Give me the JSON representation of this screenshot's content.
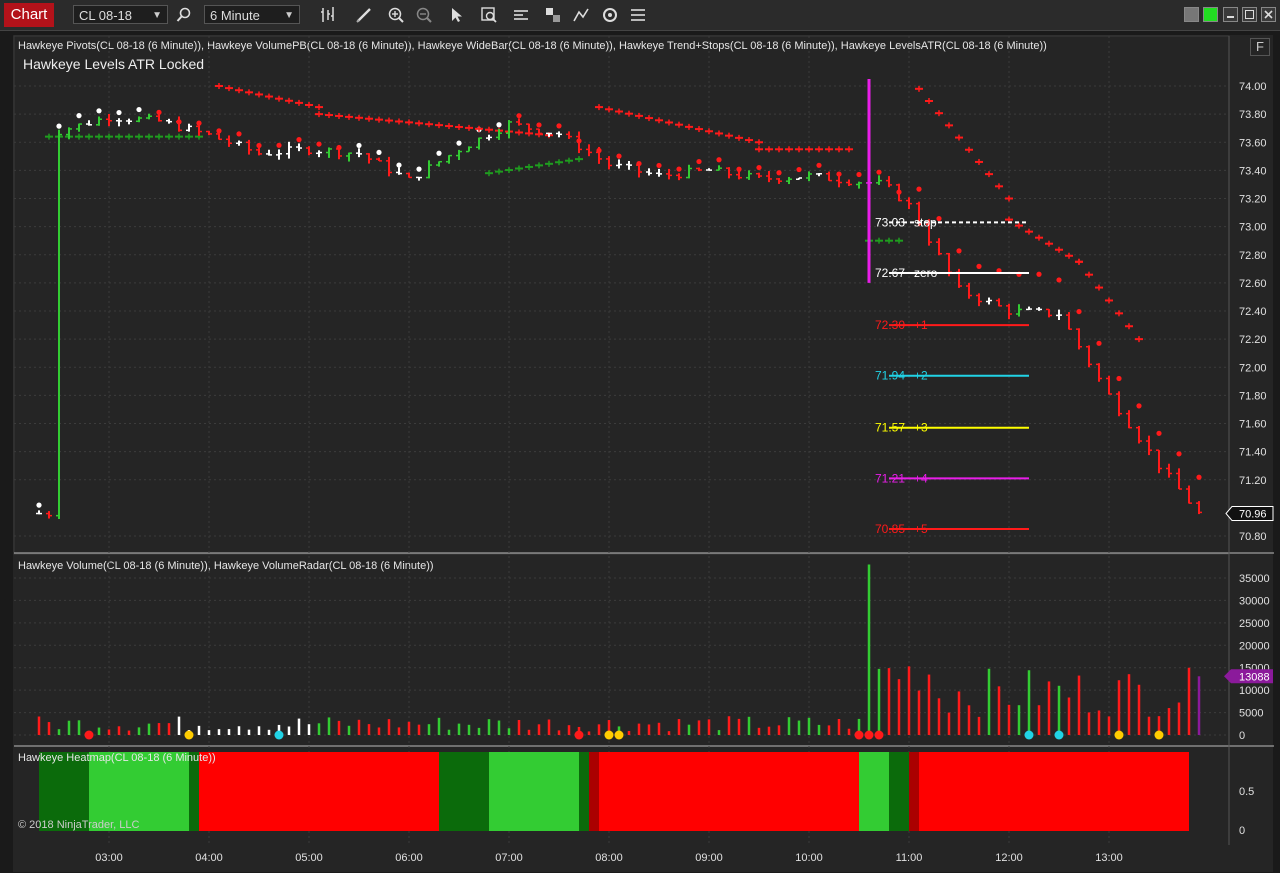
{
  "toolbar": {
    "tab_label": "Chart",
    "instrument": "CL 08-18",
    "interval": "6 Minute"
  },
  "price_panel": {
    "title": "Hawkeye Pivots(CL 08-18 (6 Minute)), Hawkeye VolumePB(CL 08-18 (6 Minute)), Hawkeye WideBar(CL 08-18 (6 Minute)), Hawkeye Trend+Stops(CL 08-18 (6 Minute)), Hawkeye LevelsATR(CL 08-18 (6 Minute))",
    "subtitle": "Hawkeye Levels ATR Locked",
    "float_button": "F",
    "y_ticks": [
      "74.00",
      "73.80",
      "73.60",
      "73.40",
      "73.20",
      "73.00",
      "72.80",
      "72.60",
      "72.40",
      "72.20",
      "72.00",
      "71.80",
      "71.60",
      "71.40",
      "71.20",
      "70.80"
    ],
    "y_tick_values": [
      74.0,
      73.8,
      73.6,
      73.4,
      73.2,
      73.0,
      72.8,
      72.6,
      72.4,
      72.2,
      72.0,
      71.8,
      71.6,
      71.4,
      71.2,
      70.8
    ],
    "last_price": "70.96",
    "last_price_value": 70.96,
    "levels": [
      {
        "price": "73.03",
        "label": "stop",
        "value": 73.03,
        "color": "#ffffff",
        "style": "dashed"
      },
      {
        "price": "72.67",
        "label": "zero",
        "value": 72.67,
        "color": "#ffffff",
        "style": "solid"
      },
      {
        "price": "72.30",
        "label": "+1",
        "value": 72.3,
        "color": "#ff1a1a",
        "style": "solid"
      },
      {
        "price": "71.94",
        "label": "+2",
        "value": 71.94,
        "color": "#21d3e6",
        "style": "solid"
      },
      {
        "price": "71.57",
        "label": "+3",
        "value": 71.57,
        "color": "#ffff00",
        "style": "solid"
      },
      {
        "price": "71.21",
        "label": "+4",
        "value": 71.21,
        "color": "#e91ee9",
        "style": "solid"
      },
      {
        "price": "70.85",
        "label": "+5",
        "value": 70.85,
        "color": "#ff1a1a",
        "style": "solid"
      }
    ]
  },
  "volume_panel": {
    "title": "Hawkeye Volume(CL 08-18 (6 Minute)), Hawkeye VolumeRadar(CL 08-18 (6 Minute))",
    "y_ticks": [
      "35000",
      "30000",
      "25000",
      "20000",
      "15000",
      "10000",
      "5000",
      "0"
    ],
    "y_tick_values": [
      35000,
      30000,
      25000,
      20000,
      15000,
      10000,
      5000,
      0
    ],
    "last_volume": "13088",
    "last_volume_value": 13088
  },
  "heatmap_panel": {
    "title": "Hawkeye Heatmap(CL 08-18 (6 Minute))",
    "y_ticks": [
      "0.5",
      "0"
    ],
    "copyright": "© 2018 NinjaTrader, LLC"
  },
  "x_axis": {
    "labels": [
      "03:00",
      "04:00",
      "05:00",
      "06:00",
      "07:00",
      "08:00",
      "09:00",
      "10:00",
      "11:00",
      "12:00",
      "13:00"
    ]
  },
  "colors": {
    "up": "#33cc33",
    "down": "#ff1a1a",
    "neutral": "#ffffff",
    "dark_green": "#0b6b0b",
    "magenta": "#e91ee9",
    "cyan": "#21d3e6",
    "gold": "#f5a623",
    "purple": "#8b1a9b",
    "tab_red": "#b3121a"
  },
  "chart_data": [
    {
      "type": "candlestick",
      "title": "Hawkeye Levels ATR Locked",
      "instrument": "CL 08-18",
      "interval": "6 Minute",
      "x_range": [
        "02:18",
        "13:54"
      ],
      "ylim": [
        70.75,
        74.1
      ],
      "series_overview": [
        {
          "time": "02:30",
          "close": 73.68
        },
        {
          "time": "03:00",
          "close": 73.78
        },
        {
          "time": "03:30",
          "close": 73.75
        },
        {
          "time": "04:00",
          "close": 73.65
        },
        {
          "time": "04:30",
          "close": 73.52
        },
        {
          "time": "05:00",
          "close": 73.55
        },
        {
          "time": "05:30",
          "close": 73.52
        },
        {
          "time": "06:00",
          "close": 73.33
        },
        {
          "time": "06:30",
          "close": 73.55
        },
        {
          "time": "07:00",
          "close": 73.73
        },
        {
          "time": "07:30",
          "close": 73.66
        },
        {
          "time": "08:00",
          "close": 73.44
        },
        {
          "time": "08:30",
          "close": 73.36
        },
        {
          "time": "09:00",
          "close": 73.4
        },
        {
          "time": "09:30",
          "close": 73.34
        },
        {
          "time": "10:00",
          "close": 73.36
        },
        {
          "time": "10:30",
          "close": 73.32
        },
        {
          "time": "10:45",
          "close": 73.3
        },
        {
          "time": "11:00",
          "close": 73.15
        },
        {
          "time": "11:30",
          "close": 72.55
        },
        {
          "time": "12:00",
          "close": 72.4
        },
        {
          "time": "12:30",
          "close": 72.38
        },
        {
          "time": "13:00",
          "close": 71.8
        },
        {
          "time": "13:30",
          "close": 71.3
        },
        {
          "time": "13:54",
          "close": 70.96
        }
      ]
    },
    {
      "type": "bar",
      "title": "Hawkeye Volume",
      "ylim": [
        0,
        38000
      ],
      "notable": [
        {
          "time": "10:36",
          "value": 38000
        },
        {
          "time": "13:54",
          "value": 13088
        }
      ]
    },
    {
      "type": "heatmap",
      "title": "Hawkeye Heatmap",
      "segments": [
        {
          "from": "02:18",
          "to": "02:48",
          "state": "dark-green"
        },
        {
          "from": "02:48",
          "to": "03:48",
          "state": "green"
        },
        {
          "from": "03:48",
          "to": "03:54",
          "state": "dark-green"
        },
        {
          "from": "03:54",
          "to": "06:18",
          "state": "red"
        },
        {
          "from": "06:18",
          "to": "06:48",
          "state": "dark-green"
        },
        {
          "from": "06:48",
          "to": "07:42",
          "state": "green"
        },
        {
          "from": "07:42",
          "to": "07:48",
          "state": "dark-green"
        },
        {
          "from": "07:48",
          "to": "07:54",
          "state": "dark-red"
        },
        {
          "from": "07:54",
          "to": "10:30",
          "state": "red"
        },
        {
          "from": "10:30",
          "to": "10:48",
          "state": "green"
        },
        {
          "from": "10:48",
          "to": "11:00",
          "state": "dark-green"
        },
        {
          "from": "11:00",
          "to": "11:06",
          "state": "dark-red"
        },
        {
          "from": "11:06",
          "to": "13:48",
          "state": "red"
        }
      ]
    }
  ]
}
